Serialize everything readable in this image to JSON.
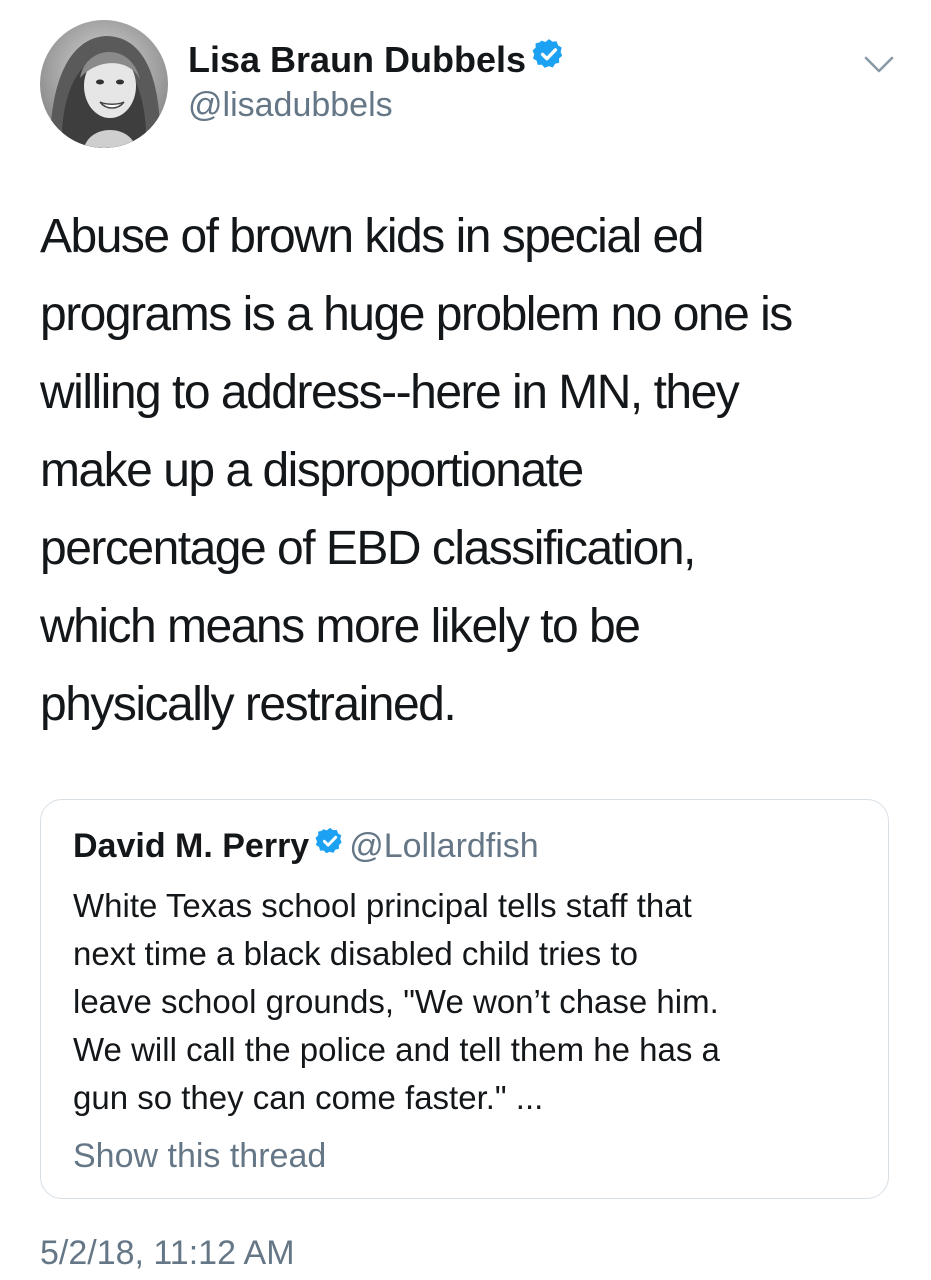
{
  "author": {
    "name": "Lisa Braun Dubbels",
    "handle": "@lisadubbels",
    "verified_icon": "verified-badge-icon"
  },
  "menu": {
    "icon": "chevron-down-icon"
  },
  "tweet": {
    "text": "Abuse of brown kids in special ed\nprograms is a huge problem no one is\nwilling to address--here in MN, they\nmake up a disproportionate\npercentage of EBD classification,\nwhich means more likely to be\nphysically restrained.",
    "timestamp": "5/2/18, 11:12 AM"
  },
  "quoted_tweet": {
    "author_name": "David M. Perry",
    "handle": "@Lollardfish",
    "text": "White Texas school principal tells staff that\nnext time a black disabled child tries to\nleave school grounds, \"We won’t chase him.\nWe will call the police and tell them he has a\ngun so they can come faster.\" ...",
    "show_thread": "Show this thread"
  },
  "colors": {
    "text": "#14171a",
    "secondary": "#657786",
    "verified": "#1da1f2",
    "border": "#d8dfe5"
  }
}
